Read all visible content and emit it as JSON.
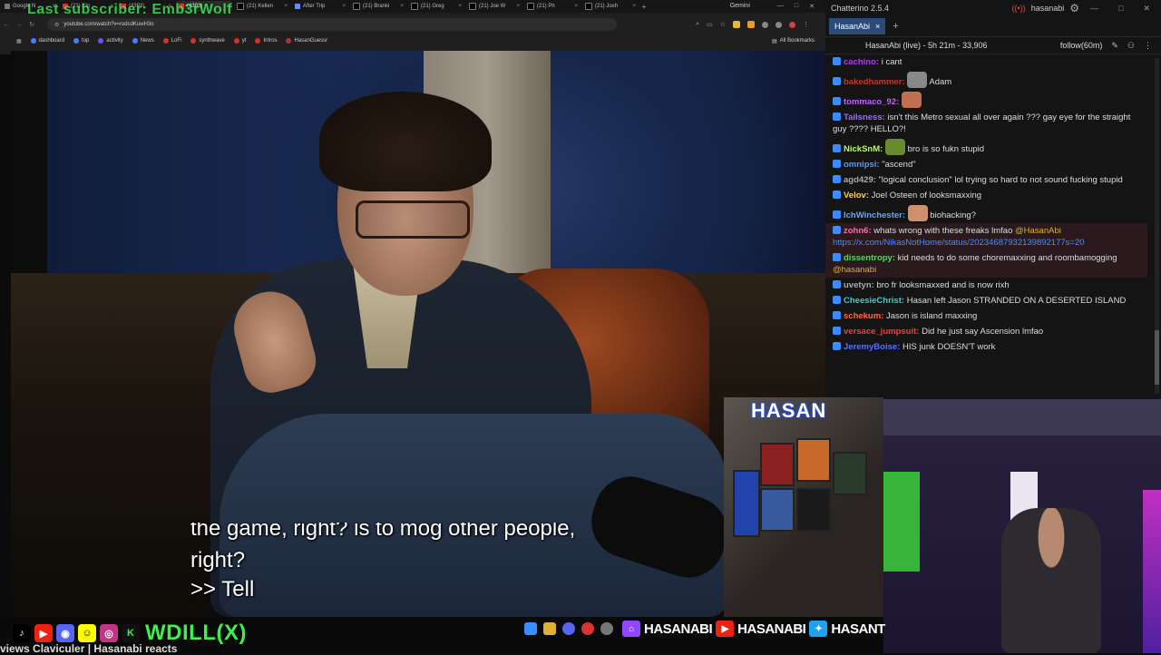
{
  "overlay": {
    "last_subscriber": "Last subscriber: Emb3rWolf"
  },
  "browser": {
    "tabs": [
      "Google N",
      "(21) clip",
      "(4393)",
      "(4393)",
      "(21) Kellen",
      "After Trip",
      "(21) Branki",
      "(21) Greg",
      "(21) Joe W",
      "(21) Ph",
      "(21) Josh",
      "Gemini"
    ],
    "url": "youtube.com/watch?v=rodcdKuwH3o",
    "bookmarks": [
      "dashboard",
      "top",
      "activity",
      "News",
      "LoFi",
      "synthwave",
      "yt",
      "Intros",
      "HasanGuessr"
    ],
    "all_bookmarks": "All Bookmarks"
  },
  "video": {
    "caption_partial": "the game, right? is to mog other people,",
    "caption_line1": "right?",
    "caption_line2": ">> Tell"
  },
  "chat": {
    "window_title": "Chatterino 2.5.4",
    "account": "hasanabi",
    "tab_label": "HasanAbi",
    "header": "HasanAbi (live) - 5h 21m - 33,906",
    "follow": "follow(60m)",
    "messages": [
      {
        "user": "cachino:",
        "color": "#b23bff",
        "text": "i cant",
        "hl": false
      },
      {
        "user": "bakedhammer:",
        "color": "#c0392b",
        "text": "Adam",
        "hl": false,
        "emote": "#888"
      },
      {
        "user": "tommaco_92:",
        "color": "#c060ff",
        "text": "",
        "hl": false,
        "emote": "#c07050"
      },
      {
        "user": "Tailsness:",
        "color": "#9b6bff",
        "text": "isn't this Metro sexual all over again ??? gay eye for the straight guy ???? HELLO?!",
        "hl": false
      },
      {
        "user": "NickSnM:",
        "color": "#b5ff5a",
        "text": "bro is so fukn stupid",
        "hl": false,
        "emote": "#6a8a30"
      },
      {
        "user": "omnipsi:",
        "color": "#4a9fff",
        "text": "\"ascend\"",
        "hl": false
      },
      {
        "user": "agd429:",
        "color": "#aaaaaa",
        "text": "\"logical conclusion\" lol trying so hard to not sound fucking stupid",
        "hl": false
      },
      {
        "user": "Velov:",
        "color": "#ffd24a",
        "text": "Joel Osteen of looksmaxxing",
        "hl": false
      },
      {
        "user": "IchWinchester:",
        "color": "#5fa8ff",
        "text": "biohacking?",
        "hl": false,
        "emote": "#d09070"
      },
      {
        "user": "zohn6:",
        "color": "#ff6aa8",
        "text": "whats wrong with these freaks lmfao",
        "mention": "@HasanAbi",
        "link": "https://x.com/NikasNotHome/status/20234687932139892177s=20",
        "hl": true
      },
      {
        "user": "dissentropy:",
        "color": "#5fd35f",
        "text": "kid needs to do some choremaxxing and roombamogging",
        "mention": "@hasanabi",
        "hl": true
      },
      {
        "user": "uvetyn:",
        "color": "#aaaaaa",
        "text": "bro fr looksmaxxed and is now rixh",
        "hl": false
      },
      {
        "user": "CheesieChrist:",
        "color": "#39d0d0",
        "text": "Hasan left Jason STRANDED ON A DESERTED ISLAND",
        "hl": false
      },
      {
        "user": "schekum:",
        "color": "#ff6a3a",
        "text": "Jason is island maxxing",
        "hl": false
      },
      {
        "user": "versace_jumpsuit:",
        "color": "#ff3a3a",
        "text": "Did he just say Ascension lmfao",
        "hl": false
      },
      {
        "user": "JeremyBoise:",
        "color": "#5a6fff",
        "text": "HIS junk DOESN'T work",
        "hl": false
      }
    ]
  },
  "webcam": {
    "logo_text": "HASAN"
  },
  "taskbar": {
    "social_handle": "WDILL(X)",
    "brand1": "HASANABI",
    "brand2": "HASANABI",
    "brand3": "HASANT",
    "ticker": "views Claviculer | Hasanabi reacts"
  }
}
